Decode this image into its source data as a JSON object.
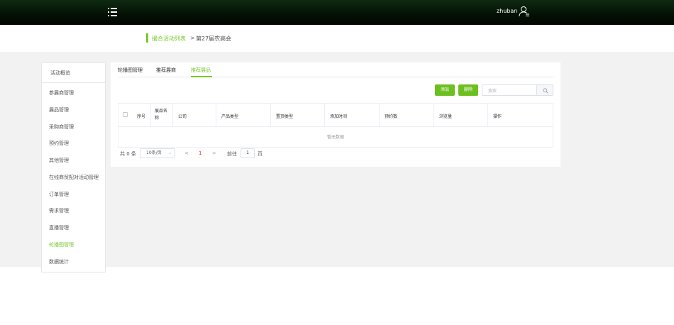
{
  "header": {
    "menu_icon": "menu-list-icon",
    "username": "zhuban",
    "user_icon": "user-icon"
  },
  "breadcrumb": {
    "link": "撮合活动列表",
    "separator": ">",
    "current": "第27届农高会"
  },
  "sidebar": {
    "header": "活动概览",
    "items": [
      {
        "label": "参展商管理"
      },
      {
        "label": "展品管理"
      },
      {
        "label": "采购商管理"
      },
      {
        "label": "预约管理"
      },
      {
        "label": "其他管理"
      },
      {
        "label": "在线商贸配对活动管理"
      },
      {
        "label": "订单管理"
      },
      {
        "label": "需求管理"
      },
      {
        "label": "直播管理"
      },
      {
        "label": "轮播图管理",
        "active": true
      },
      {
        "label": "数据统计"
      }
    ]
  },
  "tabs": [
    {
      "label": "轮播图管理"
    },
    {
      "label": "推荐展商"
    },
    {
      "label": "推荐展品",
      "active": true
    }
  ],
  "toolbar": {
    "add_label": "添加",
    "delete_label": "删除",
    "search_placeholder": "搜索",
    "search_icon": "search-icon"
  },
  "table": {
    "columns": [
      "序号",
      "展品名称",
      "公司",
      "产品类型",
      "置顶类型",
      "添加时间",
      "预约数",
      "浏览量",
      "操作"
    ],
    "empty_text": "暂无数据"
  },
  "pagination": {
    "total": "共 0 条",
    "page_size": "10条/页",
    "prev": "<",
    "current_page": "1",
    "next": ">",
    "goto_label": "前往",
    "goto_value": "1",
    "goto_suffix": "页"
  },
  "colors": {
    "accent": "#7ac82d",
    "header_bg": "#041004"
  }
}
